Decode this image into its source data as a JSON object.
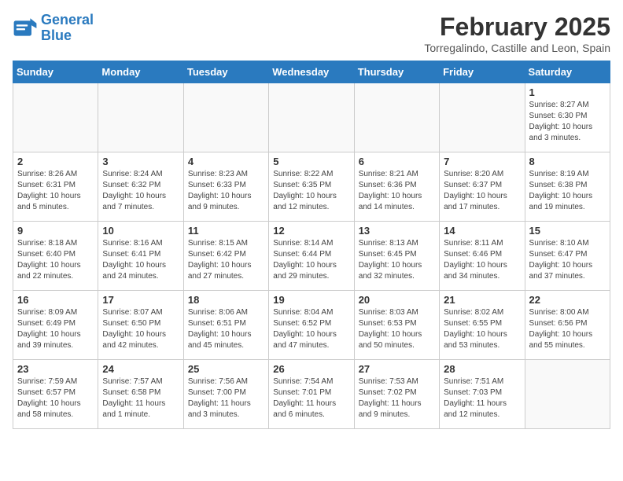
{
  "logo": {
    "line1": "General",
    "line2": "Blue"
  },
  "title": "February 2025",
  "subtitle": "Torregalindo, Castille and Leon, Spain",
  "days_of_week": [
    "Sunday",
    "Monday",
    "Tuesday",
    "Wednesday",
    "Thursday",
    "Friday",
    "Saturday"
  ],
  "weeks": [
    [
      {
        "day": "",
        "info": ""
      },
      {
        "day": "",
        "info": ""
      },
      {
        "day": "",
        "info": ""
      },
      {
        "day": "",
        "info": ""
      },
      {
        "day": "",
        "info": ""
      },
      {
        "day": "",
        "info": ""
      },
      {
        "day": "1",
        "info": "Sunrise: 8:27 AM\nSunset: 6:30 PM\nDaylight: 10 hours\nand 3 minutes."
      }
    ],
    [
      {
        "day": "2",
        "info": "Sunrise: 8:26 AM\nSunset: 6:31 PM\nDaylight: 10 hours\nand 5 minutes."
      },
      {
        "day": "3",
        "info": "Sunrise: 8:24 AM\nSunset: 6:32 PM\nDaylight: 10 hours\nand 7 minutes."
      },
      {
        "day": "4",
        "info": "Sunrise: 8:23 AM\nSunset: 6:33 PM\nDaylight: 10 hours\nand 9 minutes."
      },
      {
        "day": "5",
        "info": "Sunrise: 8:22 AM\nSunset: 6:35 PM\nDaylight: 10 hours\nand 12 minutes."
      },
      {
        "day": "6",
        "info": "Sunrise: 8:21 AM\nSunset: 6:36 PM\nDaylight: 10 hours\nand 14 minutes."
      },
      {
        "day": "7",
        "info": "Sunrise: 8:20 AM\nSunset: 6:37 PM\nDaylight: 10 hours\nand 17 minutes."
      },
      {
        "day": "8",
        "info": "Sunrise: 8:19 AM\nSunset: 6:38 PM\nDaylight: 10 hours\nand 19 minutes."
      }
    ],
    [
      {
        "day": "9",
        "info": "Sunrise: 8:18 AM\nSunset: 6:40 PM\nDaylight: 10 hours\nand 22 minutes."
      },
      {
        "day": "10",
        "info": "Sunrise: 8:16 AM\nSunset: 6:41 PM\nDaylight: 10 hours\nand 24 minutes."
      },
      {
        "day": "11",
        "info": "Sunrise: 8:15 AM\nSunset: 6:42 PM\nDaylight: 10 hours\nand 27 minutes."
      },
      {
        "day": "12",
        "info": "Sunrise: 8:14 AM\nSunset: 6:44 PM\nDaylight: 10 hours\nand 29 minutes."
      },
      {
        "day": "13",
        "info": "Sunrise: 8:13 AM\nSunset: 6:45 PM\nDaylight: 10 hours\nand 32 minutes."
      },
      {
        "day": "14",
        "info": "Sunrise: 8:11 AM\nSunset: 6:46 PM\nDaylight: 10 hours\nand 34 minutes."
      },
      {
        "day": "15",
        "info": "Sunrise: 8:10 AM\nSunset: 6:47 PM\nDaylight: 10 hours\nand 37 minutes."
      }
    ],
    [
      {
        "day": "16",
        "info": "Sunrise: 8:09 AM\nSunset: 6:49 PM\nDaylight: 10 hours\nand 39 minutes."
      },
      {
        "day": "17",
        "info": "Sunrise: 8:07 AM\nSunset: 6:50 PM\nDaylight: 10 hours\nand 42 minutes."
      },
      {
        "day": "18",
        "info": "Sunrise: 8:06 AM\nSunset: 6:51 PM\nDaylight: 10 hours\nand 45 minutes."
      },
      {
        "day": "19",
        "info": "Sunrise: 8:04 AM\nSunset: 6:52 PM\nDaylight: 10 hours\nand 47 minutes."
      },
      {
        "day": "20",
        "info": "Sunrise: 8:03 AM\nSunset: 6:53 PM\nDaylight: 10 hours\nand 50 minutes."
      },
      {
        "day": "21",
        "info": "Sunrise: 8:02 AM\nSunset: 6:55 PM\nDaylight: 10 hours\nand 53 minutes."
      },
      {
        "day": "22",
        "info": "Sunrise: 8:00 AM\nSunset: 6:56 PM\nDaylight: 10 hours\nand 55 minutes."
      }
    ],
    [
      {
        "day": "23",
        "info": "Sunrise: 7:59 AM\nSunset: 6:57 PM\nDaylight: 10 hours\nand 58 minutes."
      },
      {
        "day": "24",
        "info": "Sunrise: 7:57 AM\nSunset: 6:58 PM\nDaylight: 11 hours\nand 1 minute."
      },
      {
        "day": "25",
        "info": "Sunrise: 7:56 AM\nSunset: 7:00 PM\nDaylight: 11 hours\nand 3 minutes."
      },
      {
        "day": "26",
        "info": "Sunrise: 7:54 AM\nSunset: 7:01 PM\nDaylight: 11 hours\nand 6 minutes."
      },
      {
        "day": "27",
        "info": "Sunrise: 7:53 AM\nSunset: 7:02 PM\nDaylight: 11 hours\nand 9 minutes."
      },
      {
        "day": "28",
        "info": "Sunrise: 7:51 AM\nSunset: 7:03 PM\nDaylight: 11 hours\nand 12 minutes."
      },
      {
        "day": "",
        "info": ""
      }
    ]
  ]
}
